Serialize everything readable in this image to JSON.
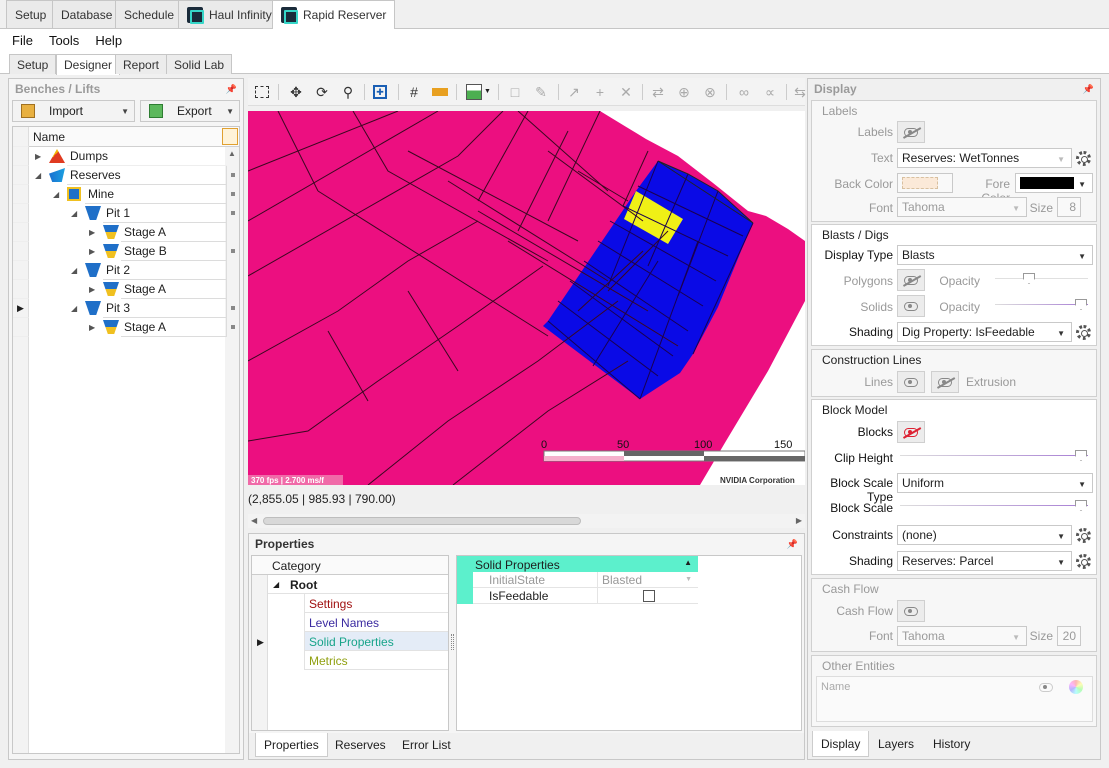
{
  "top_tabs": [
    {
      "label": "Setup"
    },
    {
      "label": "Database"
    },
    {
      "label": "Schedule"
    },
    {
      "label": "Haul Infinity"
    },
    {
      "label": "Rapid Reserver"
    }
  ],
  "menu": [
    "File",
    "Tools",
    "Help"
  ],
  "sub_tabs": [
    "Setup",
    "Designer",
    "Report",
    "Solid Lab"
  ],
  "left_panel": {
    "title": "Benches / Lifts",
    "import_label": "Import",
    "export_label": "Export",
    "column_header": "Name",
    "tree": [
      {
        "label": "Dumps"
      },
      {
        "label": "Reserves"
      },
      {
        "label": "Mine"
      },
      {
        "label": "Pit 1"
      },
      {
        "label": "Stage A"
      },
      {
        "label": "Stage B"
      },
      {
        "label": "Pit 2"
      },
      {
        "label": "Stage A"
      },
      {
        "label": "Pit 3"
      },
      {
        "label": "Stage A"
      }
    ]
  },
  "viewport": {
    "fps_text": "370 fps | 2.700 ms/f",
    "vendor_text": "NVIDIA Corporation",
    "scale_labels": [
      "0",
      "50",
      "100",
      "150"
    ],
    "coords": "(2,855.05 | 985.93 | 790.00)",
    "colors": {
      "pink": "#ec0f80",
      "blue": "#0a0ae6",
      "yellow": "#f0f016"
    }
  },
  "properties": {
    "title": "Properties",
    "category_header": "Category",
    "root_label": "Root",
    "categories": [
      {
        "label": "Settings",
        "color": "#a01010"
      },
      {
        "label": "Level Names",
        "color": "#3a2aa0"
      },
      {
        "label": "Solid Properties",
        "color": "#17a48a"
      },
      {
        "label": "Metrics",
        "color": "#90a010"
      }
    ],
    "grid_header": "Solid Properties",
    "rows": [
      {
        "name": "InitialState",
        "value": "Blasted"
      },
      {
        "name": "IsFeedable",
        "value": ""
      }
    ],
    "bottom_tabs": [
      "Properties",
      "Reserves",
      "Error List"
    ]
  },
  "display": {
    "title": "Display",
    "labels_group": {
      "title": "Labels",
      "labels": "Labels",
      "text": "Text",
      "text_value": "Reserves: WetTonnes",
      "back_color": "Back Color",
      "fore_color": "Fore Color",
      "font": "Font",
      "font_value": "Tahoma",
      "size": "Size",
      "size_value": "8"
    },
    "blasts_group": {
      "title": "Blasts / Digs",
      "display_type": "Display Type",
      "display_type_value": "Blasts",
      "polygons": "Polygons",
      "solids": "Solids",
      "opacity": "Opacity",
      "shading": "Shading",
      "shading_value": "Dig Property: IsFeedable"
    },
    "construction_group": {
      "title": "Construction Lines",
      "lines": "Lines",
      "extrusion": "Extrusion"
    },
    "block_group": {
      "title": "Block Model",
      "blocks": "Blocks",
      "clip_height": "Clip Height",
      "block_scale_type": "Block Scale Type",
      "block_scale_type_value": "Uniform",
      "block_scale": "Block Scale",
      "constraints": "Constraints",
      "constraints_value": "(none)",
      "shading": "Shading",
      "shading_value": "Reserves: Parcel"
    },
    "cashflow_group": {
      "title": "Cash Flow",
      "cash_flow": "Cash Flow",
      "font": "Font",
      "font_value": "Tahoma",
      "size": "Size",
      "size_value": "20"
    },
    "other_group": {
      "title": "Other Entities",
      "name_placeholder": "Name"
    },
    "bottom_tabs": [
      "Display",
      "Layers",
      "History"
    ]
  }
}
